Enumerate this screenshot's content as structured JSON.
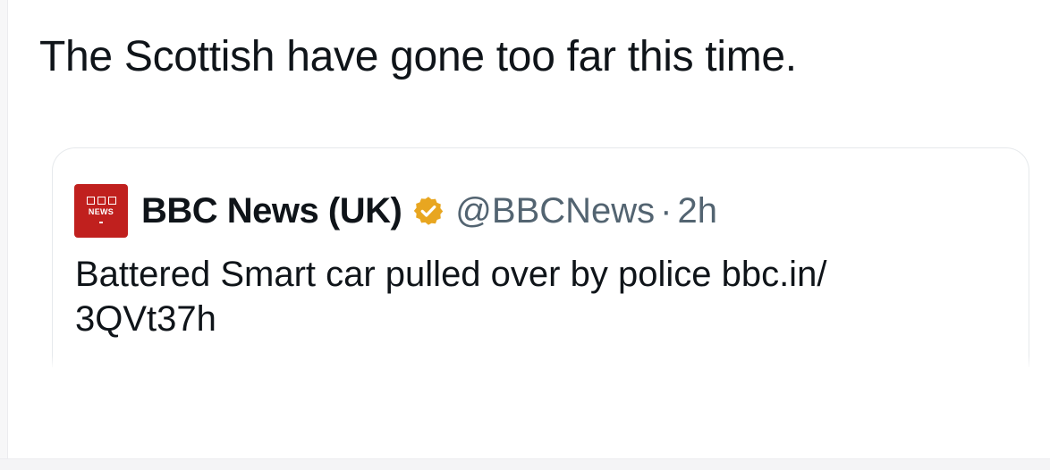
{
  "tweet": {
    "text": "The Scottish have gone too far this time."
  },
  "quoted_tweet": {
    "logo": {
      "icon": "bbc-news-logo-icon",
      "letters": [
        "B",
        "B",
        "C"
      ],
      "sublabel": "NEWS",
      "color": "#c0201e"
    },
    "display_name": "BBC News (UK)",
    "verified_icon": "gold-verified-badge-icon",
    "verified_color": "#e8a620",
    "handle": "@BBCNews",
    "separator": "·",
    "time": "2h",
    "text_line1": "Battered Smart car pulled over by police bbc.in/",
    "text_line2": "3QVt37h"
  },
  "colors": {
    "text": "#0f1419",
    "secondary_text": "#536471",
    "card_border": "#e6e9ec"
  }
}
